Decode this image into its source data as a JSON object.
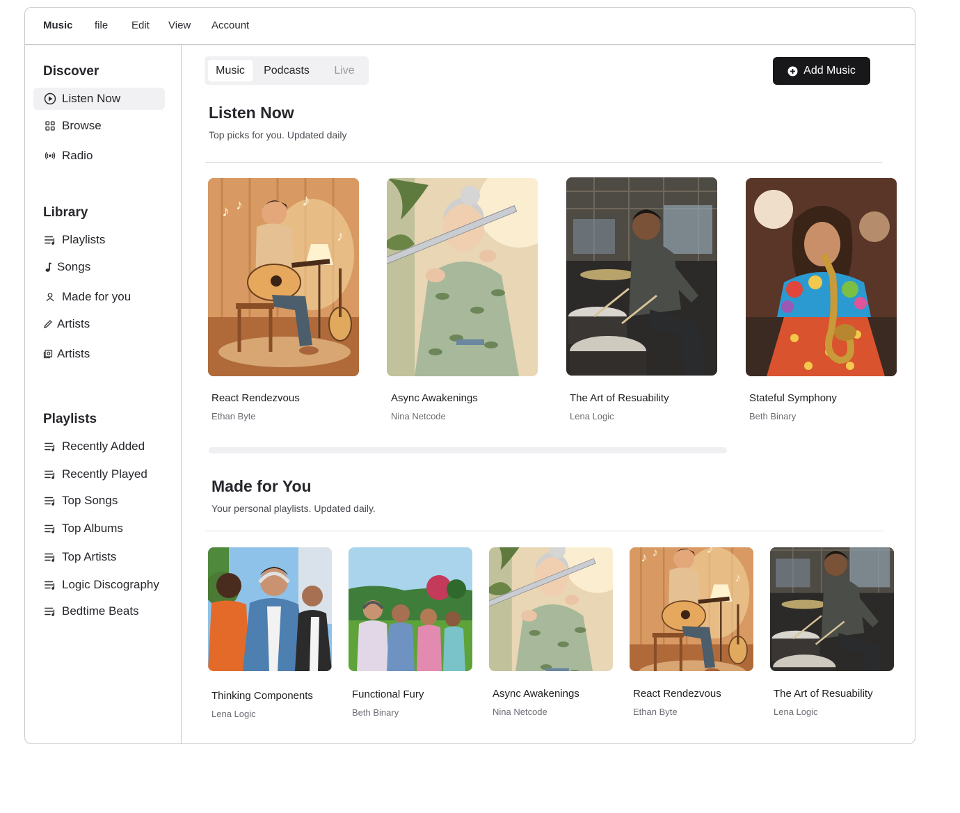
{
  "menubar": {
    "brand": "Music",
    "items": [
      "file",
      "Edit",
      "View",
      "Account"
    ]
  },
  "sidebar": {
    "discover": {
      "title": "Discover",
      "items": [
        {
          "label": "Listen Now",
          "icon": "play-circle-icon"
        },
        {
          "label": "Browse",
          "icon": "grid-icon"
        },
        {
          "label": "Radio",
          "icon": "radio-icon"
        }
      ]
    },
    "library": {
      "title": "Library",
      "items": [
        {
          "label": "Playlists",
          "icon": "list-music-icon"
        },
        {
          "label": "Songs",
          "icon": "music-note-icon"
        },
        {
          "label": "Made for you",
          "icon": "user-icon"
        },
        {
          "label": "Artists",
          "icon": "pencil-icon"
        },
        {
          "label": "Artists",
          "icon": "album-icon"
        }
      ]
    },
    "playlists": {
      "title": "Playlists",
      "items": [
        {
          "label": "Recently Added",
          "icon": "list-music-icon"
        },
        {
          "label": "Recently Played",
          "icon": "list-music-icon"
        },
        {
          "label": "Top Songs",
          "icon": "list-music-icon"
        },
        {
          "label": "Top Albums",
          "icon": "list-music-icon"
        },
        {
          "label": "Top Artists",
          "icon": "list-music-icon"
        },
        {
          "label": "Logic Discography",
          "icon": "list-music-icon"
        },
        {
          "label": "Bedtime Beats",
          "icon": "list-music-icon"
        }
      ]
    }
  },
  "tabs": [
    {
      "label": "Music",
      "state": "active"
    },
    {
      "label": "Podcasts",
      "state": "normal"
    },
    {
      "label": "Live",
      "state": "disabled"
    }
  ],
  "add_button": {
    "label": "Add Music",
    "icon": "plus-circle-icon"
  },
  "listen_now": {
    "title": "Listen Now",
    "subtitle": "Top picks for you. Updated daily",
    "albums": [
      {
        "title": "React Rendezvous",
        "artist": "Ethan Byte",
        "art": "guitarist-illustration"
      },
      {
        "title": "Async Awakenings",
        "artist": "Nina Netcode",
        "art": "flutist-illustration"
      },
      {
        "title": "The Art of Resuability",
        "artist": "Lena Logic",
        "art": "drummer-photo"
      },
      {
        "title": "Stateful Symphony",
        "artist": "Beth Binary",
        "art": "saxophonist-photo"
      }
    ]
  },
  "made_for_you": {
    "title": "Made for You",
    "subtitle": "Your personal playlists. Updated daily.",
    "albums": [
      {
        "title": "Thinking Components",
        "artist": "Lena Logic",
        "art": "friends-headphones-photo"
      },
      {
        "title": "Functional Fury",
        "artist": "Beth Binary",
        "art": "park-listeners-photo"
      },
      {
        "title": "Async Awakenings",
        "artist": "Nina Netcode",
        "art": "flutist-illustration"
      },
      {
        "title": "React Rendezvous",
        "artist": "Ethan Byte",
        "art": "guitarist-illustration"
      },
      {
        "title": "The Art of Resuability",
        "artist": "Lena Logic",
        "art": "drummer-photo"
      }
    ]
  },
  "colors": {
    "accent": "#18181b",
    "active_bg": "#f1f1f3",
    "border": "#c9c9ce",
    "muted_text": "#6c6c74"
  }
}
